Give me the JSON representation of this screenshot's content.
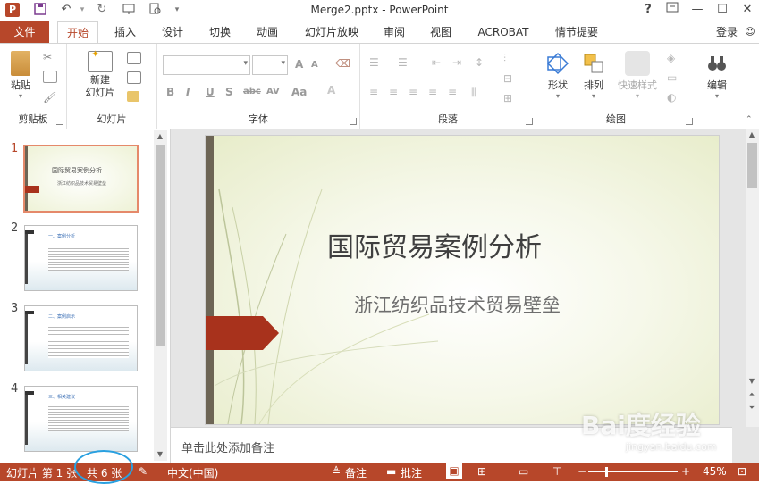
{
  "window": {
    "title": "Merge2.pptx - PowerPoint",
    "help": "?",
    "restore_icon": "ribbon-display-icon",
    "minimize": "—",
    "maximize": "☐",
    "close": "✕"
  },
  "quick_access": [
    "powerpoint-logo-icon",
    "save-icon",
    "undo-icon",
    "redo-icon",
    "present-icon",
    "preview-icon",
    "customize-icon"
  ],
  "tabs": [
    {
      "label": "文件"
    },
    {
      "label": "开始"
    },
    {
      "label": "插入"
    },
    {
      "label": "设计"
    },
    {
      "label": "切换"
    },
    {
      "label": "动画"
    },
    {
      "label": "幻灯片放映"
    },
    {
      "label": "审阅"
    },
    {
      "label": "视图"
    },
    {
      "label": "ACROBAT"
    },
    {
      "label": "情节提要"
    }
  ],
  "signin": "登录",
  "ribbon": {
    "clipboard": {
      "group": "剪贴板",
      "paste": "粘贴"
    },
    "slides": {
      "group": "幻灯片",
      "new_slide": "新建\n幻灯片"
    },
    "font": {
      "group": "字体",
      "bold": "B",
      "italic": "I",
      "underline": "U",
      "shadow": "S",
      "strike": "abc",
      "spacing": "AV",
      "case": "Aa",
      "grow": "A",
      "shrink": "A"
    },
    "paragraph": {
      "group": "段落"
    },
    "drawing": {
      "group": "绘图",
      "shapes": "形状",
      "arrange": "排列",
      "quick_styles": "快速样式"
    },
    "editing": {
      "label": "编辑"
    }
  },
  "thumbnails": [
    {
      "num": "1",
      "title": "国际贸易案例分析",
      "subtitle": "浙江纺织品技术贸易壁垒"
    },
    {
      "num": "2",
      "title": "一、案例分析"
    },
    {
      "num": "3",
      "title": "二、案例启示"
    },
    {
      "num": "4",
      "title": "三、相关建议"
    }
  ],
  "slide": {
    "title": "国际贸易案例分析",
    "subtitle": "浙江纺织品技术贸易壁垒",
    "accent_color": "#a8321c",
    "bar_color": "#6d6555"
  },
  "notes_placeholder": "单击此处添加备注",
  "status": {
    "slide_info": "幻灯片 第 1 张",
    "total": "共 6 张",
    "language": "中文(中国)",
    "notes": "备注",
    "comments": "批注",
    "zoom": "45%",
    "zoom_minus": "−",
    "zoom_plus": "+"
  },
  "watermark": {
    "text": "Bai度经验",
    "sub": "jingyan.baidu.com"
  },
  "colors": {
    "accent": "#b7472a",
    "highlight": "#29a0e0"
  }
}
